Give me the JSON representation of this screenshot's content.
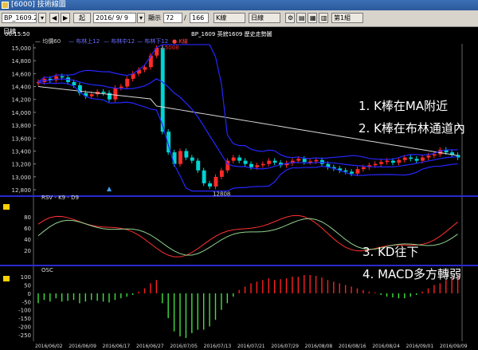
{
  "window": {
    "title": "[6000] 技術線圖"
  },
  "toolbar": {
    "symbol": "BP_1609.2",
    "from_label": "起",
    "date": "2016/ 9/ 9",
    "display_label": "顯示",
    "display_count": "72",
    "total": "166",
    "chart_type": "K線",
    "period": "日線",
    "group": "第1組"
  },
  "info": {
    "period": "日線",
    "time": "00:15:50",
    "title": "BP_1609 英鎊1609  歷史走勢圖"
  },
  "legend": {
    "ma": "均價60",
    "boll_up": "布林上12",
    "boll_mid": "布林中12",
    "boll_dn": "布林下12",
    "k": "K線"
  },
  "price_axis": [
    "15,000",
    "14,800",
    "14,600",
    "14,400",
    "14,200",
    "14,000",
    "13,800",
    "13,600",
    "13,400",
    "13,200",
    "13,000",
    "12,800"
  ],
  "kd": {
    "label": "RSV - K9 - D9",
    "ticks": [
      "80",
      "60",
      "40",
      "20"
    ]
  },
  "osc": {
    "label": "OSC",
    "ticks": [
      "100",
      "50",
      "0",
      "-50",
      "-100",
      "-150",
      "-200",
      "-250"
    ]
  },
  "dates": [
    "2016/06/02",
    "2016/06/09",
    "2016/06/17",
    "2016/06/27",
    "2016/07/05",
    "2016/07/13",
    "2016/07/21",
    "2016/07/29",
    "2016/08/08",
    "2016/08/16",
    "2016/08/24",
    "2016/09/01",
    "2016/09/09"
  ],
  "annotations": {
    "high": "15008",
    "low": "12808",
    "note1": "1. K棒在MA附近",
    "note2": "2. K棒在布林通道內",
    "note3": "3. KD往下",
    "note4": "4. MACD多方轉弱"
  },
  "colors": {
    "up": "#ff2a2a",
    "down": "#00d4d4",
    "ma": "#d8d8d8",
    "boll": "#2626ff",
    "k": "#ff3030",
    "d": "#8fd28f",
    "panel_sep": "#2a2ad0",
    "osc_pos": "#ff2020",
    "osc_neg": "#40e040"
  },
  "chart_data": {
    "type": "line",
    "closes": [
      14470,
      14520,
      14500,
      14560,
      14540,
      14470,
      14420,
      14300,
      14250,
      14280,
      14320,
      14300,
      14200,
      14380,
      14400,
      14520,
      14600,
      14660,
      14700,
      14880,
      15000,
      13700,
      13380,
      13200,
      13400,
      13300,
      13250,
      13100,
      12900,
      12850,
      13000,
      13100,
      13250,
      13300,
      13250,
      13200,
      13150,
      13180,
      13200,
      13250,
      13220,
      13180,
      13210,
      13250,
      13280,
      13230,
      13240,
      13260,
      13200,
      13150,
      13130,
      13100,
      13080,
      13050,
      13120,
      13150,
      13180,
      13200,
      13230,
      13250,
      13220,
      13260,
      13300,
      13280,
      13250,
      13300,
      13330,
      13350,
      13420,
      13380,
      13340,
      13300
    ],
    "osc": [
      -60,
      -40,
      -50,
      -30,
      -50,
      -45,
      -40,
      -60,
      -50,
      -40,
      -45,
      -50,
      -55,
      -40,
      -30,
      -20,
      -10,
      10,
      30,
      60,
      80,
      -60,
      -150,
      -230,
      -260,
      -270,
      -240,
      -220,
      -220,
      -200,
      -160,
      -100,
      -60,
      -20,
      20,
      40,
      60,
      70,
      80,
      90,
      80,
      85,
      90,
      100,
      100,
      110,
      110,
      105,
      95,
      80,
      70,
      60,
      50,
      40,
      30,
      20,
      10,
      5,
      -10,
      -20,
      -25,
      -30,
      -30,
      -20,
      -10,
      10,
      30,
      50,
      60,
      80,
      90,
      110
    ]
  }
}
